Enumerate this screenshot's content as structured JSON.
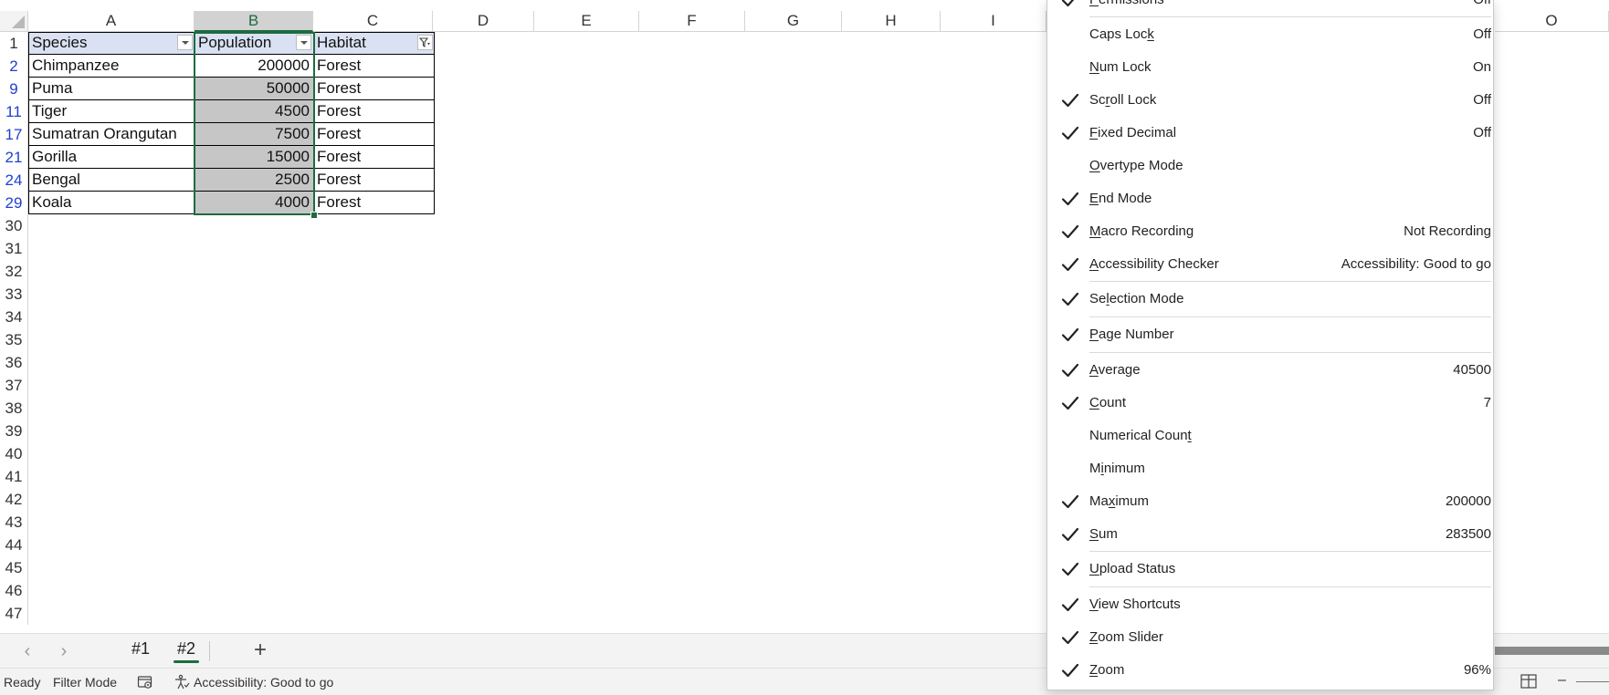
{
  "columns": [
    "A",
    "B",
    "C",
    "D",
    "E",
    "F",
    "G",
    "H",
    "I",
    "O"
  ],
  "table": {
    "headers": [
      "Species",
      "Population",
      "Habitat"
    ],
    "rows": [
      {
        "row": "2",
        "species": "Chimpanzee",
        "population": "200000",
        "habitat": "Forest"
      },
      {
        "row": "9",
        "species": "Puma",
        "population": "50000",
        "habitat": "Forest"
      },
      {
        "row": "11",
        "species": "Tiger",
        "population": "4500",
        "habitat": "Forest"
      },
      {
        "row": "17",
        "species": "Sumatran Orangutan",
        "population": "7500",
        "habitat": "Forest"
      },
      {
        "row": "21",
        "species": "Gorilla",
        "population": "15000",
        "habitat": "Forest"
      },
      {
        "row": "24",
        "species": "Bengal",
        "population": "2500",
        "habitat": "Forest"
      },
      {
        "row": "29",
        "species": "Koala",
        "population": "4000",
        "habitat": "Forest"
      }
    ]
  },
  "header_row_number": "1",
  "empty_rows": [
    "30",
    "31",
    "32",
    "33",
    "34",
    "35",
    "36",
    "37",
    "38",
    "39",
    "40",
    "41",
    "42",
    "43",
    "44",
    "45",
    "46",
    "47"
  ],
  "sheet_tabs": {
    "prev_icon": "chevron-left-icon",
    "next_icon": "chevron-right-icon",
    "tabs": [
      "#1",
      "#2"
    ],
    "active": "#2",
    "add_label": "+"
  },
  "status_bar": {
    "ready": "Ready",
    "filter_mode": "Filter Mode",
    "accessibility": "Accessibility: Good to go"
  },
  "context_menu": {
    "items": [
      {
        "key": "permissions",
        "label": "Permissions",
        "accel": "P",
        "checked": true,
        "value": "Off"
      },
      {
        "key": "caps-lock",
        "label": "Caps Lock",
        "accel": "k",
        "checked": false,
        "value": "Off"
      },
      {
        "key": "num-lock",
        "label": "Num Lock",
        "accel": "N",
        "checked": false,
        "value": "On"
      },
      {
        "key": "scroll-lock",
        "label": "Scroll Lock",
        "accel": "r",
        "checked": true,
        "value": "Off"
      },
      {
        "key": "fixed-decimal",
        "label": "Fixed Decimal",
        "accel": "F",
        "checked": true,
        "value": "Off"
      },
      {
        "key": "overtype-mode",
        "label": "Overtype Mode",
        "accel": "O",
        "checked": false,
        "value": ""
      },
      {
        "key": "end-mode",
        "label": "End Mode",
        "accel": "E",
        "checked": true,
        "value": ""
      },
      {
        "key": "macro-recording",
        "label": "Macro Recording",
        "accel": "M",
        "checked": true,
        "value": "Not Recording"
      },
      {
        "key": "accessibility-checker",
        "label": "Accessibility Checker",
        "accel": "A",
        "checked": true,
        "value": "Accessibility: Good to go"
      },
      {
        "key": "selection-mode",
        "label": "Selection Mode",
        "accel": "l",
        "checked": true,
        "value": ""
      },
      {
        "key": "page-number",
        "label": "Page Number",
        "accel": "P",
        "checked": true,
        "value": ""
      },
      {
        "key": "average",
        "label": "Average",
        "accel": "A",
        "checked": true,
        "value": "40500"
      },
      {
        "key": "count",
        "label": "Count",
        "accel": "C",
        "checked": true,
        "value": "7"
      },
      {
        "key": "numerical-count",
        "label": "Numerical Count",
        "accel": "t",
        "checked": false,
        "value": ""
      },
      {
        "key": "minimum",
        "label": "Minimum",
        "accel": "i",
        "checked": false,
        "value": ""
      },
      {
        "key": "maximum",
        "label": "Maximum",
        "accel": "x",
        "checked": true,
        "value": "200000"
      },
      {
        "key": "sum",
        "label": "Sum",
        "accel": "S",
        "checked": true,
        "value": "283500"
      },
      {
        "key": "upload-status",
        "label": "Upload Status",
        "accel": "U",
        "checked": true,
        "value": ""
      },
      {
        "key": "view-shortcuts",
        "label": "View Shortcuts",
        "accel": "V",
        "checked": true,
        "value": ""
      },
      {
        "key": "zoom-slider",
        "label": "Zoom Slider",
        "accel": "Z",
        "checked": true,
        "value": ""
      },
      {
        "key": "zoom",
        "label": "Zoom",
        "accel": "Z",
        "checked": true,
        "value": "96%"
      }
    ]
  },
  "colors": {
    "accent_green": "#1e6b40",
    "header_fill": "#d9e1f2",
    "selection_fill": "#c6c6c6",
    "filtered_row_number": "#1f3fd0"
  }
}
